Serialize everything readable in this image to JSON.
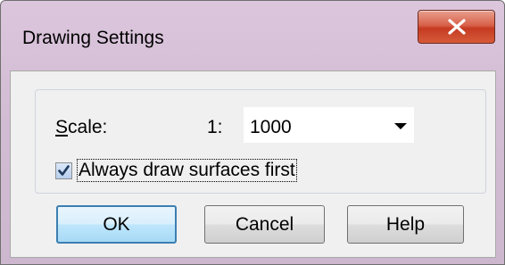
{
  "window": {
    "title": "Drawing Settings",
    "close_icon": "close-x-icon"
  },
  "scale": {
    "label_accel": "S",
    "label_rest": "cale:",
    "ratio_prefix": "1:",
    "value": "1000",
    "dropdown_icon": "chevron-down-icon"
  },
  "surfaces_option": {
    "label": "Always draw surfaces first",
    "checked": true
  },
  "buttons": {
    "ok": "OK",
    "cancel": "Cancel",
    "help": "Help"
  },
  "colors": {
    "title_bar": "#d3bdd5",
    "close_button": "#c53b22",
    "default_button_border": "#3c7fb1"
  }
}
